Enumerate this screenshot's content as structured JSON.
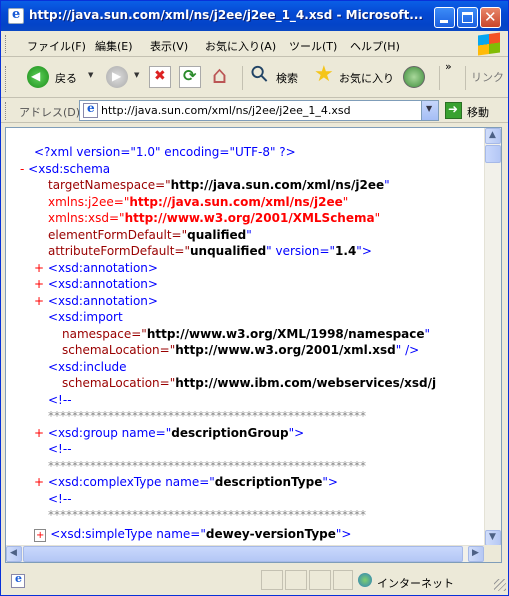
{
  "window": {
    "title": "http://java.sun.com/xml/ns/j2ee/j2ee_1_4.xsd - Microsoft..."
  },
  "menu": {
    "items": [
      "ファイル(F)",
      "編集(E)",
      "表示(V)",
      "お気に入り(A)",
      "ツール(T)",
      "ヘルプ(H)"
    ]
  },
  "toolbar": {
    "back_label": "戻る",
    "search_label": "検索",
    "favorites_label": "お気に入り",
    "chevron": "»",
    "links_label": "リンク"
  },
  "address": {
    "label": "アドレス(D)",
    "url": "http://java.sun.com/xml/ns/j2ee/j2ee_1_4.xsd",
    "go_label": "移動"
  },
  "xml": {
    "decl": "<?xml version=\"1.0\" encoding=\"UTF-8\" ?>",
    "minus": "-",
    "plus": "+",
    "schema_open": "<xsd:schema",
    "tn_attr": "targetNamespace=\"",
    "tn_val": "http://java.sun.com/xml/ns/j2ee",
    "q": "\"",
    "j2ee_attr": "xmlns:j2ee=\"",
    "j2ee_val": "http://java.sun.com/xml/ns/j2ee",
    "xsd_attr": "xmlns:xsd=\"",
    "xsd_val": "http://www.w3.org/2001/XMLSchema",
    "efd_attr": "elementFormDefault=\"",
    "efd_val": "qualified",
    "afd_attr": "attributeFormDefault=\"",
    "afd_val": "unqualified",
    "ver_attr": "\" version=\"",
    "ver_val": "1.4",
    "ver_end": "\">",
    "annotation": "<xsd:annotation>",
    "import_open": "<xsd:import",
    "ns_attr": "namespace=\"",
    "ns_val": "http://www.w3.org/XML/1998/namespace",
    "sl_attr": "schemaLocation=\"",
    "sl_val": "http://www.w3.org/2001/xml.xsd",
    "sl_end": "\" />",
    "include_open": "<xsd:include",
    "sl2_val": "http://www.ibm.com/webservices/xsd/j",
    "comment_open": "<!--",
    "stars": "*****************************************************",
    "group_open": "<xsd:group name=\"",
    "group_val": "descriptionGroup",
    "tag_end": "\">",
    "ct_open": "<xsd:complexType name=\"",
    "ct_val": "descriptionType",
    "st_open": "<xsd:simpleType name=\"",
    "st_val": "dewey-versionType"
  },
  "status": {
    "zone_label": "インターネット"
  }
}
